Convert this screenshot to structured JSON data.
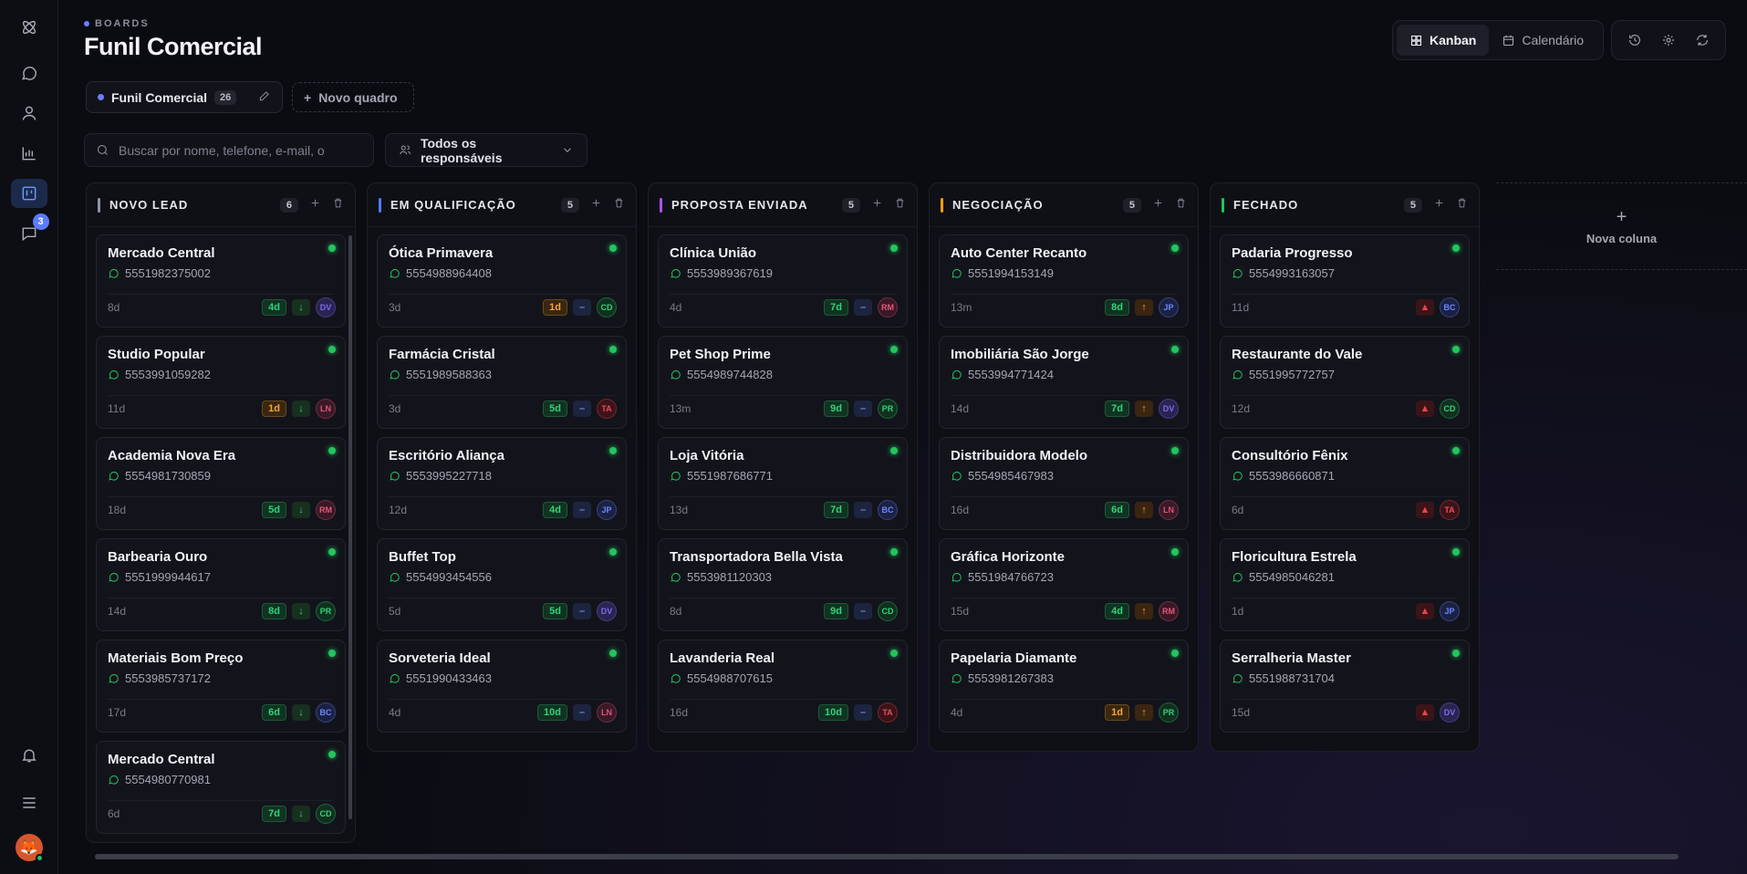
{
  "sidebar": {
    "badge_count": "3"
  },
  "header": {
    "eyebrow": "BOARDS",
    "title": "Funil Comercial",
    "view_kanban": "Kanban",
    "view_calendar": "Calendário"
  },
  "boards": {
    "active_name": "Funil Comercial",
    "active_count": "26",
    "new_board": "Novo quadro"
  },
  "filters": {
    "search_placeholder": "Buscar por nome, telefone, e-mail, o",
    "responsible": "Todos os responsáveis"
  },
  "new_column": "Nova coluna",
  "colors": {
    "novo_lead": "#8e93a8",
    "em_qualificacao": "#4f7cff",
    "proposta_enviada": "#a855f7",
    "negociacao": "#f59e0b",
    "fechado": "#22c55e"
  },
  "columns": [
    {
      "title": "NOVO LEAD",
      "count": "6",
      "color": "#8e93a8",
      "cards": [
        {
          "name": "Mercado Central",
          "phone": "5551982375002",
          "age": "8d",
          "days": "4d",
          "tag": "green",
          "prio": "low",
          "avatar": "DV"
        },
        {
          "name": "Studio Popular",
          "phone": "5553991059282",
          "age": "11d",
          "days": "1d",
          "tag": "amber",
          "prio": "low",
          "avatar": "LN"
        },
        {
          "name": "Academia Nova Era",
          "phone": "5554981730859",
          "age": "18d",
          "days": "5d",
          "tag": "green",
          "prio": "low",
          "avatar": "RM"
        },
        {
          "name": "Barbearia Ouro",
          "phone": "5551999944617",
          "age": "14d",
          "days": "8d",
          "tag": "green",
          "prio": "low",
          "avatar": "PR"
        },
        {
          "name": "Materiais Bom Preço",
          "phone": "5553985737172",
          "age": "17d",
          "days": "6d",
          "tag": "green",
          "prio": "low",
          "avatar": "BC"
        },
        {
          "name": "Mercado Central",
          "phone": "5554980770981",
          "age": "6d",
          "days": "7d",
          "tag": "green",
          "prio": "low",
          "avatar": "CD"
        }
      ]
    },
    {
      "title": "EM QUALIFICAÇÃO",
      "count": "5",
      "color": "#4f7cff",
      "cards": [
        {
          "name": "Ótica Primavera",
          "phone": "5554988964408",
          "age": "3d",
          "days": "1d",
          "tag": "amber",
          "prio": "med",
          "avatar": "CD"
        },
        {
          "name": "Farmácia Cristal",
          "phone": "5551989588363",
          "age": "3d",
          "days": "5d",
          "tag": "green",
          "prio": "med",
          "avatar": "TA"
        },
        {
          "name": "Escritório Aliança",
          "phone": "5553995227718",
          "age": "12d",
          "days": "4d",
          "tag": "green",
          "prio": "med",
          "avatar": "JP"
        },
        {
          "name": "Buffet Top",
          "phone": "5554993454556",
          "age": "5d",
          "days": "5d",
          "tag": "green",
          "prio": "med",
          "avatar": "DV"
        },
        {
          "name": "Sorveteria Ideal",
          "phone": "5551990433463",
          "age": "4d",
          "days": "10d",
          "tag": "green",
          "prio": "med",
          "avatar": "LN"
        }
      ]
    },
    {
      "title": "PROPOSTA ENVIADA",
      "count": "5",
      "color": "#a855f7",
      "cards": [
        {
          "name": "Clínica União",
          "phone": "5553989367619",
          "age": "4d",
          "days": "7d",
          "tag": "green",
          "prio": "med",
          "avatar": "RM"
        },
        {
          "name": "Pet Shop Prime",
          "phone": "5554989744828",
          "age": "13m",
          "days": "9d",
          "tag": "green",
          "prio": "med",
          "avatar": "PR"
        },
        {
          "name": "Loja Vitória",
          "phone": "5551987686771",
          "age": "13d",
          "days": "7d",
          "tag": "green",
          "prio": "med",
          "avatar": "BC"
        },
        {
          "name": "Transportadora Bella Vista",
          "phone": "5553981120303",
          "age": "8d",
          "days": "9d",
          "tag": "green",
          "prio": "med",
          "avatar": "CD"
        },
        {
          "name": "Lavanderia Real",
          "phone": "5554988707615",
          "age": "16d",
          "days": "10d",
          "tag": "green",
          "prio": "med",
          "avatar": "TA"
        }
      ]
    },
    {
      "title": "NEGOCIAÇÃO",
      "count": "5",
      "color": "#f59e0b",
      "cards": [
        {
          "name": "Auto Center Recanto",
          "phone": "5551994153149",
          "age": "13m",
          "days": "8d",
          "tag": "green",
          "prio": "high",
          "avatar": "JP"
        },
        {
          "name": "Imobiliária São Jorge",
          "phone": "5553994771424",
          "age": "14d",
          "days": "7d",
          "tag": "green",
          "prio": "high",
          "avatar": "DV"
        },
        {
          "name": "Distribuidora Modelo",
          "phone": "5554985467983",
          "age": "16d",
          "days": "6d",
          "tag": "green",
          "prio": "high",
          "avatar": "LN"
        },
        {
          "name": "Gráfica Horizonte",
          "phone": "5551984766723",
          "age": "15d",
          "days": "4d",
          "tag": "green",
          "prio": "high",
          "avatar": "RM"
        },
        {
          "name": "Papelaria Diamante",
          "phone": "5553981267383",
          "age": "4d",
          "days": "1d",
          "tag": "amber",
          "prio": "high",
          "avatar": "PR"
        }
      ]
    },
    {
      "title": "FECHADO",
      "count": "5",
      "color": "#22c55e",
      "cards": [
        {
          "name": "Padaria Progresso",
          "phone": "5554993163057",
          "age": "11d",
          "days": "",
          "tag": "",
          "prio": "urgent",
          "avatar": "BC"
        },
        {
          "name": "Restaurante do Vale",
          "phone": "5551995772757",
          "age": "12d",
          "days": "",
          "tag": "",
          "prio": "urgent",
          "avatar": "CD"
        },
        {
          "name": "Consultório Fênix",
          "phone": "5553986660871",
          "age": "6d",
          "days": "",
          "tag": "",
          "prio": "urgent",
          "avatar": "TA"
        },
        {
          "name": "Floricultura Estrela",
          "phone": "5554985046281",
          "age": "1d",
          "days": "",
          "tag": "",
          "prio": "urgent",
          "avatar": "JP"
        },
        {
          "name": "Serralheria Master",
          "phone": "5551988731704",
          "age": "15d",
          "days": "",
          "tag": "",
          "prio": "urgent",
          "avatar": "DV"
        }
      ]
    }
  ]
}
